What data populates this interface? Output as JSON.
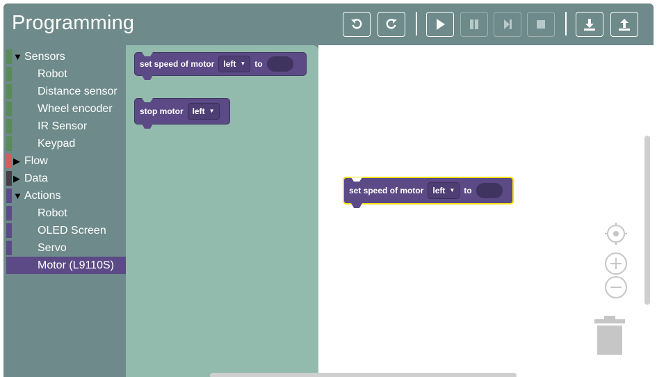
{
  "app": {
    "title": "Programming"
  },
  "toolbar": {
    "buttons": [
      {
        "name": "undo-button",
        "icon": "undo-icon",
        "enabled": true
      },
      {
        "name": "redo-button",
        "icon": "redo-icon",
        "enabled": true
      },
      {
        "name": "run-button",
        "icon": "play-icon",
        "enabled": true
      },
      {
        "name": "pause-button",
        "icon": "pause-icon",
        "enabled": false
      },
      {
        "name": "step-button",
        "icon": "step-forward-icon",
        "enabled": false
      },
      {
        "name": "stop-button",
        "icon": "stop-icon",
        "enabled": false
      },
      {
        "name": "download-button",
        "icon": "download-icon",
        "enabled": true
      },
      {
        "name": "upload-button",
        "icon": "upload-icon",
        "enabled": true
      }
    ]
  },
  "toolbox": {
    "items": [
      {
        "label": "Sensors",
        "level": 0,
        "expanded": true,
        "color": "#5a8a57"
      },
      {
        "label": "Robot",
        "level": 1,
        "color": "#5a8a57"
      },
      {
        "label": "Distance sensor",
        "level": 1,
        "color": "#5a8a57"
      },
      {
        "label": "Wheel encoder",
        "level": 1,
        "color": "#5a8a57"
      },
      {
        "label": "IR Sensor",
        "level": 1,
        "color": "#5a8a57"
      },
      {
        "label": "Keypad",
        "level": 1,
        "color": "#5a8a57"
      },
      {
        "label": "Flow",
        "level": 0,
        "expanded": false,
        "color": "#d45e5e"
      },
      {
        "label": "Data",
        "level": 0,
        "expanded": false,
        "color": "#4a3b44"
      },
      {
        "label": "Actions",
        "level": 0,
        "expanded": true,
        "color": "#5b4a86"
      },
      {
        "label": "Robot",
        "level": 1,
        "color": "#5b4a86"
      },
      {
        "label": "OLED Screen",
        "level": 1,
        "color": "#5b4a86"
      },
      {
        "label": "Servo",
        "level": 1,
        "color": "#5b4a86"
      },
      {
        "label": "Motor (L9110S)",
        "level": 1,
        "color": "#5b4a86",
        "selected": true
      }
    ]
  },
  "flyout": {
    "blocks": [
      {
        "text": "set speed of motor",
        "dropdown": "left",
        "suffix": "to"
      },
      {
        "text": "stop motor",
        "dropdown": "left"
      }
    ]
  },
  "workspace": {
    "blocks": [
      {
        "text": "set speed of motor",
        "dropdown": "left",
        "suffix": "to"
      }
    ]
  },
  "colors": {
    "header": "#6e8a8a",
    "flyout": "#93bbad",
    "block": "#5b4a86",
    "highlight": "#f4df12"
  }
}
